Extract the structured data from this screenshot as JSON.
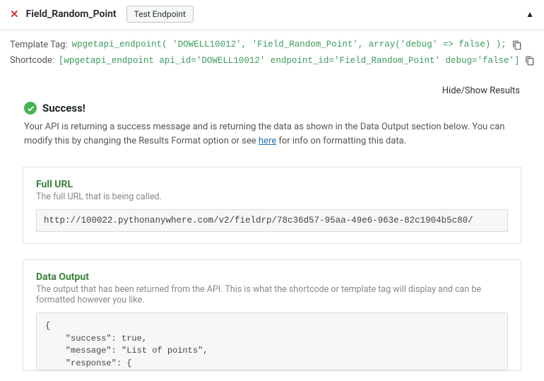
{
  "header": {
    "title": "Field_Random_Point",
    "test_button": "Test Endpoint"
  },
  "tags": {
    "template_label": "Template Tag:",
    "template_code": "wpgetapi_endpoint( 'DOWELL10012', 'Field_Random_Point', array('debug' => false) );",
    "shortcode_label": "Shortcode:",
    "shortcode_code": "[wpgetapi_endpoint api_id='DOWELL10012' endpoint_id='Field_Random_Point' debug='false']"
  },
  "results": {
    "hide_show": "Hide/Show Results",
    "success_title": "Success!",
    "msg_part1": "Your API is returning a success message and is returning the data as shown in the Data Output section below. You can modify this by changing the Results Format option or see ",
    "msg_link": "here",
    "msg_part2": " for info on formatting this data."
  },
  "full_url": {
    "title": "Full URL",
    "sub": "The full URL that is being called.",
    "value": "http://100022.pythonanywhere.com/v2/fieldrp/78c36d57-95aa-49e6-963e-82c1904b5c80/"
  },
  "data_output": {
    "title": "Data Output",
    "sub": "The output that has been returned from the API. This is what the shortcode or template tag will display and can be formatted however you like.",
    "json": "{\n    \"success\": true,\n    \"message\": \"List of points\",\n    \"response\": {\n        \"input_data\": {"
  }
}
